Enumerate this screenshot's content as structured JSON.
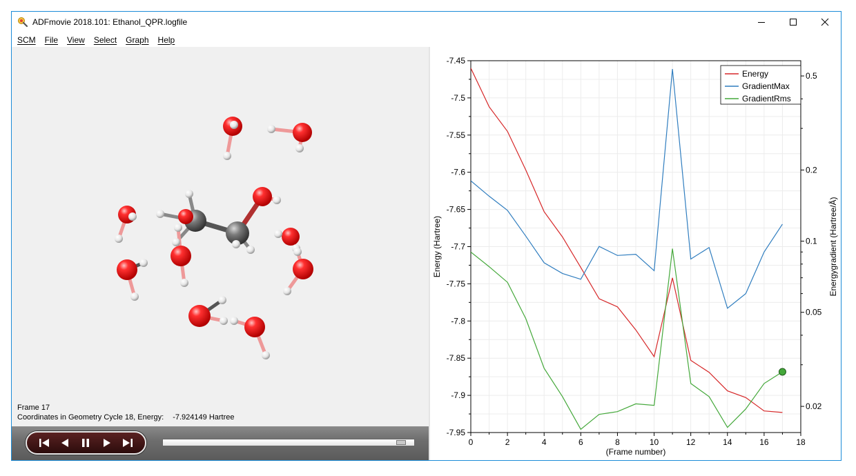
{
  "window": {
    "title": "ADFmovie 2018.101: Ethanol_QPR.logfile"
  },
  "menu": {
    "items": [
      "SCM",
      "File",
      "View",
      "Select",
      "Graph",
      "Help"
    ]
  },
  "viewer": {
    "frame_label": "Frame 17",
    "coords_label": "Coordinates in Geometry Cycle 18, Energy:",
    "coords_value": "-7.924149 Hartree"
  },
  "player": {
    "buttons": [
      "first-frame-icon",
      "step-back-icon",
      "pause-icon",
      "step-forward-icon",
      "last-frame-icon"
    ],
    "slider_position": 0.97
  },
  "chart_data": {
    "type": "line",
    "xlabel": "(Frame number)",
    "ylabel_left": "Energy (Hartree)",
    "ylabel_right": "Energygradient (Hartree/Å)",
    "xlim": [
      0,
      18
    ],
    "x_ticks": [
      0,
      2,
      4,
      6,
      8,
      10,
      12,
      14,
      16,
      18
    ],
    "ylim_left": [
      -7.95,
      -7.45
    ],
    "y_ticks_left": [
      -7.45,
      -7.5,
      -7.55,
      -7.6,
      -7.65,
      -7.7,
      -7.75,
      -7.8,
      -7.85,
      -7.9,
      -7.95
    ],
    "y_tick_labels_left": [
      "-7.45",
      "-7.5",
      "-7.55",
      "-7.6",
      "-7.65",
      "-7.7",
      "-7.75",
      "-7.8",
      "-7.85",
      "-7.9",
      "-7.95"
    ],
    "right_axis_scale": "log",
    "ylim_right": [
      0.0155,
      0.58
    ],
    "y_ticks_right": [
      0.5,
      0.2,
      0.1,
      0.05,
      0.02
    ],
    "y_tick_labels_right": [
      "0.5",
      "0.2",
      "0.1",
      "0.05",
      "0.02"
    ],
    "grid": true,
    "legend_position": "top-right",
    "highlighted_frame": 17,
    "x": [
      0,
      1,
      2,
      3,
      4,
      5,
      6,
      7,
      8,
      9,
      10,
      11,
      12,
      13,
      14,
      15,
      16,
      17
    ],
    "series": [
      {
        "name": "Energy",
        "axis": "left",
        "color": "#d62728",
        "values": [
          -7.46,
          -7.512,
          -7.545,
          -7.597,
          -7.653,
          -7.687,
          -7.728,
          -7.77,
          -7.781,
          -7.812,
          -7.848,
          -7.742,
          -7.853,
          -7.869,
          -7.894,
          -7.903,
          -7.921,
          -7.923
        ]
      },
      {
        "name": "GradientMax",
        "axis": "right",
        "color": "#2f7dbf",
        "values": [
          0.18,
          0.155,
          0.135,
          0.105,
          0.081,
          0.073,
          0.069,
          0.095,
          0.087,
          0.088,
          0.075,
          0.535,
          0.084,
          0.094,
          0.052,
          0.06,
          0.09,
          0.118
        ]
      },
      {
        "name": "GradientRms",
        "axis": "right",
        "color": "#44a83a",
        "values": [
          0.09,
          0.078,
          0.067,
          0.047,
          0.029,
          0.022,
          0.016,
          0.0185,
          0.019,
          0.0205,
          0.0202,
          0.093,
          0.025,
          0.022,
          0.0163,
          0.0195,
          0.025,
          0.028
        ]
      }
    ]
  }
}
